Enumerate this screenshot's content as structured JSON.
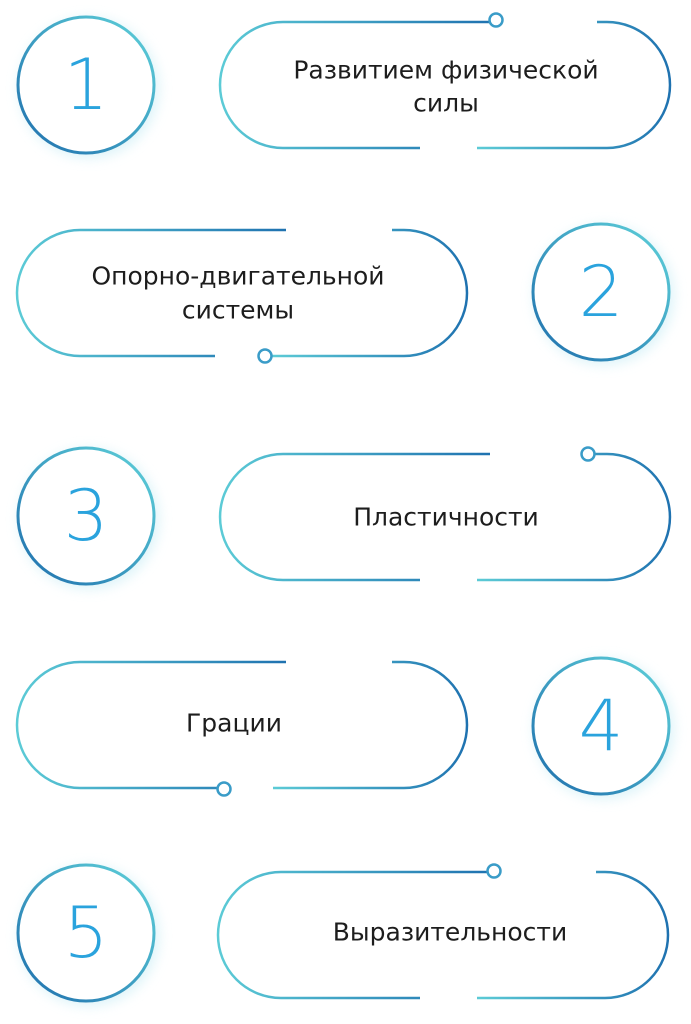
{
  "steps": [
    {
      "number": "1",
      "label_lines": [
        "Развитием физической",
        "силы"
      ]
    },
    {
      "number": "2",
      "label_lines": [
        "Опорно-двигательной",
        "системы"
      ]
    },
    {
      "number": "3",
      "label_lines": [
        "Пластичности"
      ]
    },
    {
      "number": "4",
      "label_lines": [
        "Грации"
      ]
    },
    {
      "number": "5",
      "label_lines": [
        "Выразительности"
      ]
    }
  ],
  "colors": {
    "teal": "#5ccbd6",
    "blue": "#1f79b5",
    "digit": "#2aa3dd",
    "glow": "#bfeaf3",
    "text": "#1d1d1d"
  }
}
